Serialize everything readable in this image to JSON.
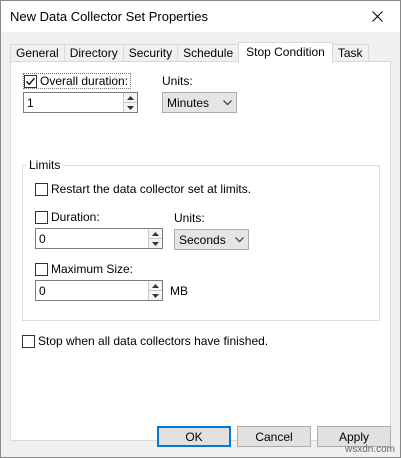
{
  "window": {
    "title": "New Data Collector Set Properties"
  },
  "tabs": [
    {
      "label": "General"
    },
    {
      "label": "Directory"
    },
    {
      "label": "Security"
    },
    {
      "label": "Schedule"
    },
    {
      "label": "Stop Condition"
    },
    {
      "label": "Task"
    }
  ],
  "overall_duration": {
    "label": "Overall duration:",
    "checked": true,
    "value": "1",
    "units_label": "Units:",
    "units_value": "Minutes"
  },
  "limits": {
    "title": "Limits",
    "restart_label": "Restart the data collector set at limits.",
    "restart_checked": false,
    "duration_label": "Duration:",
    "duration_checked": false,
    "duration_value": "0",
    "units_label": "Units:",
    "units_value": "Seconds",
    "max_size_label": "Maximum Size:",
    "max_size_checked": false,
    "max_size_value": "0",
    "max_size_unit": "MB"
  },
  "stop_all": {
    "label": "Stop when all data collectors have finished.",
    "checked": false
  },
  "buttons": {
    "ok": "OK",
    "cancel": "Cancel",
    "apply": "Apply"
  },
  "watermark": "wsxdn.com"
}
